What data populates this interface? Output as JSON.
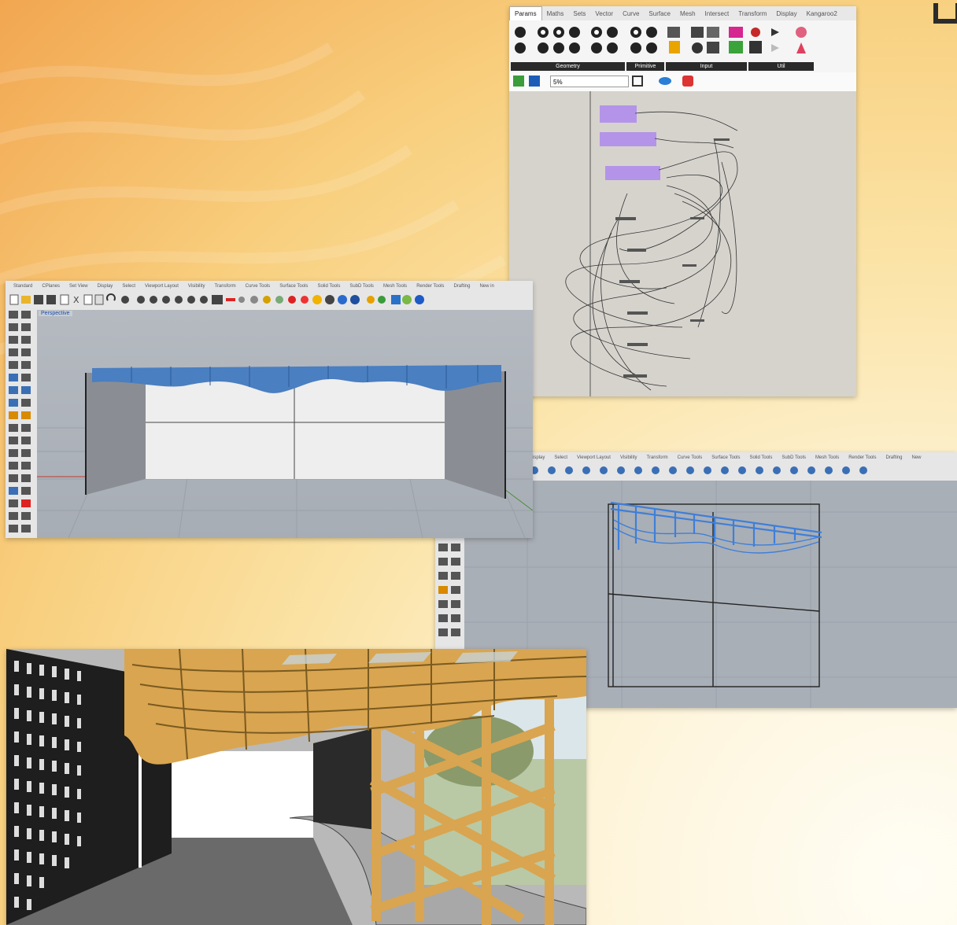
{
  "grasshopper": {
    "tabs": [
      "Params",
      "Maths",
      "Sets",
      "Vector",
      "Curve",
      "Surface",
      "Mesh",
      "Intersect",
      "Transform",
      "Display",
      "Kangaroo2"
    ],
    "active_tab": "Params",
    "groups": [
      {
        "label": "Geometry",
        "w": 145
      },
      {
        "label": "Primitive",
        "w": 48
      },
      {
        "label": "Input",
        "w": 103
      },
      {
        "label": "Util",
        "w": 83
      }
    ],
    "zoom": "5%",
    "accent": "#b494e8"
  },
  "rhino_perspective": {
    "menu": [
      "Standard",
      "CPlanes",
      "Set View",
      "Display",
      "Select",
      "Viewport Layout",
      "Visibility",
      "Transform",
      "Curve Tools",
      "Surface Tools",
      "Solid Tools",
      "SubD Tools",
      "Mesh Tools",
      "Render Tools",
      "Drafting",
      "New in"
    ],
    "viewport_label": "Perspective",
    "model_color": "#4a7fc1"
  },
  "rhino_front": {
    "menu": [
      "isplay",
      "Select",
      "Viewport Layout",
      "Visibility",
      "Transform",
      "Curve Tools",
      "Surface Tools",
      "Solid Tools",
      "SubD Tools",
      "Mesh Tools",
      "Render Tools",
      "Drafting",
      "New"
    ]
  },
  "render": {
    "wood_color": "#d9a550"
  }
}
